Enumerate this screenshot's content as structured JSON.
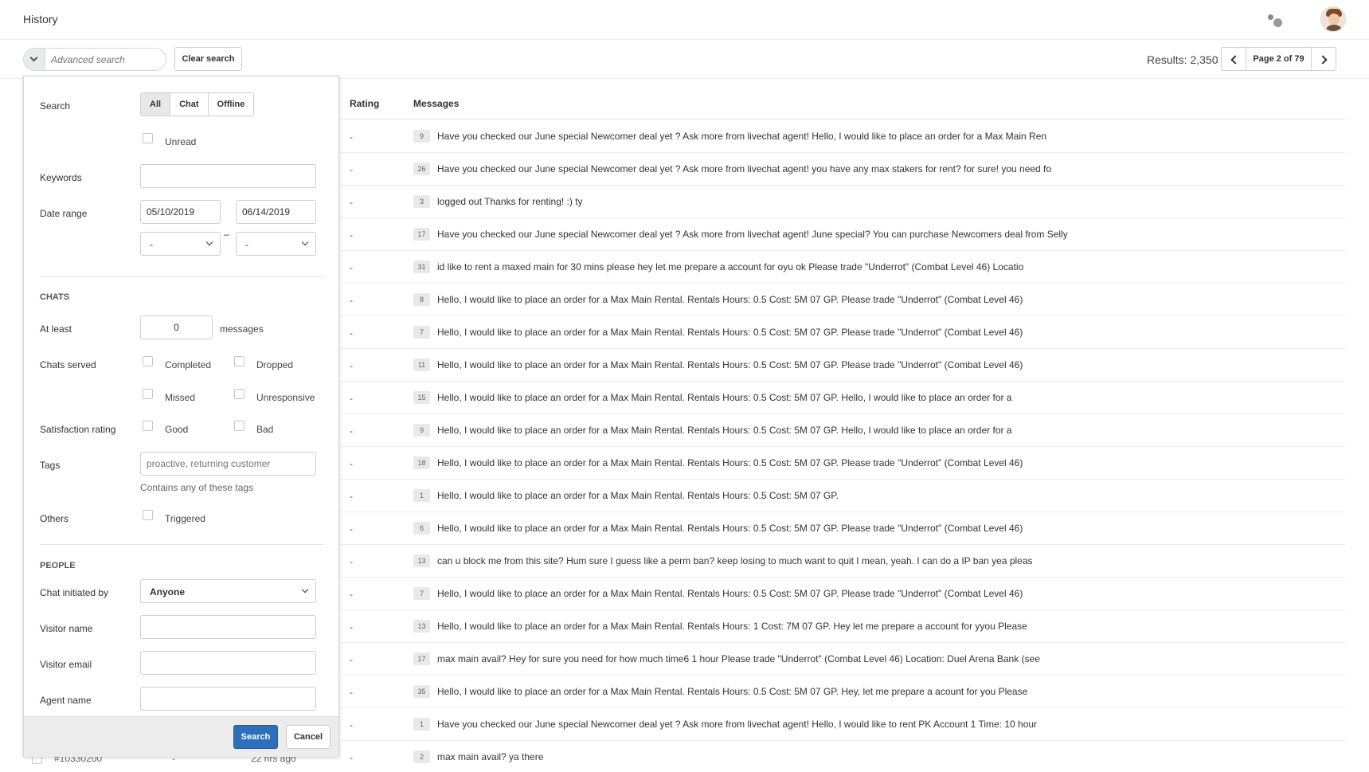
{
  "header": {
    "title": "History",
    "apps_icon": "dots-icon",
    "avatar_icon": "user-avatar"
  },
  "toolbar": {
    "search_placeholder": "Advanced search",
    "clear_label": "Clear search",
    "results": "Results: 2,350",
    "page_label": "Page 2 of 79"
  },
  "table": {
    "headers": {
      "rating": "Rating",
      "messages": "Messages"
    },
    "rows": [
      {
        "rating": "-",
        "count": "9",
        "message": "Have you checked our June special Newcomer deal yet ? Ask more from livechat agent! Hello, I would like to place an order for a Max Main Ren"
      },
      {
        "rating": "-",
        "count": "26",
        "message": "Have you checked our June special Newcomer deal yet ? Ask more from livechat agent! you have any max stakers for rent? for sure! you need fo"
      },
      {
        "rating": "-",
        "count": "3",
        "message": "logged out Thanks for renting! :) ty"
      },
      {
        "rating": "-",
        "count": "17",
        "message": "Have you checked our June special Newcomer deal yet ? Ask more from livechat agent! June special? You can purchase Newcomers deal from Selly"
      },
      {
        "rating": "-",
        "count": "31",
        "message": "id like to rent a maxed main for 30 mins please hey let me prepare a account for oyu ok Please trade \"Underrot\" (Combat Level 46) Locatio"
      },
      {
        "rating": "-",
        "count": "8",
        "message": "Hello, I would like to place an order for a Max Main Rental. Rentals Hours: 0.5 Cost: 5M 07 GP. Please trade \"Underrot\" (Combat Level 46)"
      },
      {
        "rating": "-",
        "count": "7",
        "message": "Hello, I would like to place an order for a Max Main Rental. Rentals Hours: 0.5 Cost: 5M 07 GP. Please trade \"Underrot\" (Combat Level 46)"
      },
      {
        "rating": "-",
        "count": "11",
        "message": "Hello, I would like to place an order for a Max Main Rental. Rentals Hours: 0.5 Cost: 5M 07 GP. Please trade \"Underrot\" (Combat Level 46)"
      },
      {
        "rating": "-",
        "count": "15",
        "message": "Hello, I would like to place an order for a Max Main Rental. Rentals Hours: 0.5 Cost: 5M 07 GP. Hello, I would like to place an order for a"
      },
      {
        "rating": "-",
        "count": "9",
        "message": "Hello, I would like to place an order for a Max Main Rental. Rentals Hours: 0.5 Cost: 5M 07 GP. Hello, I would like to place an order for a"
      },
      {
        "rating": "-",
        "count": "18",
        "message": "Hello, I would like to place an order for a Max Main Rental. Rentals Hours: 0.5 Cost: 5M 07 GP. Please trade \"Underrot\" (Combat Level 46)"
      },
      {
        "rating": "-",
        "count": "1",
        "message": "Hello, I would like to place an order for a Max Main Rental. Rentals Hours: 0.5 Cost: 5M 07 GP."
      },
      {
        "rating": "-",
        "count": "6",
        "message": "Hello, I would like to place an order for a Max Main Rental. Rentals Hours: 0.5 Cost: 5M 07 GP. Please trade \"Underrot\" (Combat Level 46)"
      },
      {
        "rating": "-",
        "count": "13",
        "message": "can u block me from this site? Hum sure I guess like a perm ban? keep losing to much want to quit I mean, yeah. I can do a IP ban yea pleas"
      },
      {
        "rating": "-",
        "count": "7",
        "message": "Hello, I would like to place an order for a Max Main Rental. Rentals Hours: 0.5 Cost: 5M 07 GP. Please trade \"Underrot\" (Combat Level 46)"
      },
      {
        "rating": "-",
        "count": "13",
        "message": "Hello, I would like to place an order for a Max Main Rental. Rentals Hours: 1 Cost: 7M 07 GP. Hey let me prepare a account for yyou Please"
      },
      {
        "rating": "-",
        "count": "17",
        "message": "max main avail? Hey for sure you need for how much time6 1 hour Please trade \"Underrot\" (Combat Level 46) Location: Duel Arena Bank (see"
      },
      {
        "rating": "-",
        "count": "35",
        "message": "Hello, I would like to place an order for a Max Main Rental. Rentals Hours: 0.5 Cost: 5M 07 GP. Hey, let me prepare a acount for you Please"
      },
      {
        "rating": "-",
        "count": "1",
        "message": "Have you checked our June special Newcomer deal yet ? Ask more from livechat agent! Hello, I would like to rent PK Account 1 Time: 10 hour"
      },
      {
        "rating": "-",
        "count": "2",
        "message": "max main avail? ya there"
      }
    ],
    "peek_row": {
      "id": "#10330200",
      "rating": "-",
      "ago": "22 hrs ago"
    }
  },
  "panel": {
    "search_label": "Search",
    "segments": [
      "All",
      "Chat",
      "Offline"
    ],
    "active_segment": "All",
    "unread_label": "Unread",
    "keywords_label": "Keywords",
    "keywords_value": "",
    "date_range_label": "Date range",
    "date_from": "05/10/2019",
    "date_to": "06/14/2019",
    "time_from": "-",
    "time_to": "-",
    "range_dash": "–",
    "chats_section": "CHATS",
    "at_least_label": "At least",
    "at_least_value": "0",
    "messages_label": "messages",
    "chats_served_label": "Chats served",
    "completed_label": "Completed",
    "dropped_label": "Dropped",
    "missed_label": "Missed",
    "unresponsive_label": "Unresponsive",
    "satisfaction_label": "Satisfaction rating",
    "good_label": "Good",
    "bad_label": "Bad",
    "tags_label": "Tags",
    "tags_placeholder": "proactive, returning customer",
    "tags_hint": "Contains any of these tags",
    "others_label": "Others",
    "triggered_label": "Triggered",
    "people_section": "PEOPLE",
    "initiated_label": "Chat initiated by",
    "initiated_value": "Anyone",
    "visitor_name_label": "Visitor name",
    "visitor_email_label": "Visitor email",
    "agent_name_label": "Agent name",
    "search_button": "Search",
    "cancel_button": "Cancel"
  }
}
